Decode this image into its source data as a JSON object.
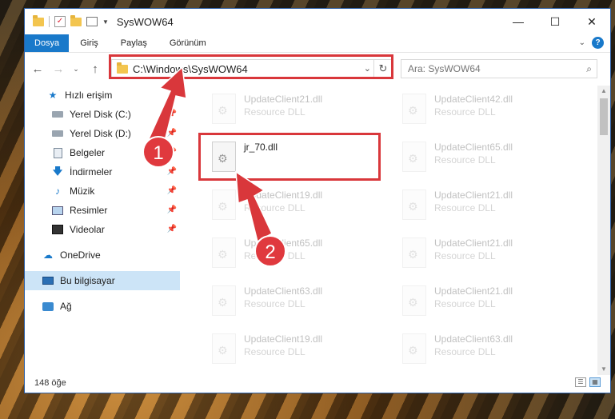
{
  "window": {
    "title": "SysWOW64"
  },
  "ribbon": {
    "tabs": [
      "Dosya",
      "Giriş",
      "Paylaş",
      "Görünüm"
    ]
  },
  "address": {
    "path": "C:\\Windows\\SysWOW64"
  },
  "search": {
    "placeholder": "Ara: SysWOW64"
  },
  "sidebar": {
    "items": [
      {
        "label": "Hızlı erişim"
      },
      {
        "label": "Yerel Disk (C:)"
      },
      {
        "label": "Yerel Disk (D:)"
      },
      {
        "label": "Belgeler"
      },
      {
        "label": "İndirmeler"
      },
      {
        "label": "Müzik"
      },
      {
        "label": "Resimler"
      },
      {
        "label": "Videolar"
      },
      {
        "label": "OneDrive"
      },
      {
        "label": "Bu bilgisayar"
      },
      {
        "label": "Ağ"
      }
    ]
  },
  "files": [
    {
      "name": "UpdateClient21.dll",
      "type": "Resource DLL"
    },
    {
      "name": "UpdateClient42.dll",
      "type": "Resource DLL"
    },
    {
      "name": "jr_70.dll",
      "type": ""
    },
    {
      "name": "UpdateClient65.dll",
      "type": "Resource DLL"
    },
    {
      "name": "UpdateClient19.dll",
      "type": "Resource DLL"
    },
    {
      "name": "UpdateClient21.dll",
      "type": "Resource DLL"
    },
    {
      "name": "UpdateClient65.dll",
      "type": "Resource DLL"
    },
    {
      "name": "UpdateClient21.dll",
      "type": "Resource DLL"
    },
    {
      "name": "UpdateClient63.dll",
      "type": "Resource DLL"
    },
    {
      "name": "UpdateClient21.dll",
      "type": "Resource DLL"
    },
    {
      "name": "UpdateClient19.dll",
      "type": "Resource DLL"
    },
    {
      "name": "UpdateClient63.dll",
      "type": "Resource DLL"
    }
  ],
  "status": {
    "count": "148 öğe"
  },
  "annotations": {
    "step1": "1",
    "step2": "2",
    "color": "#d9373b"
  }
}
